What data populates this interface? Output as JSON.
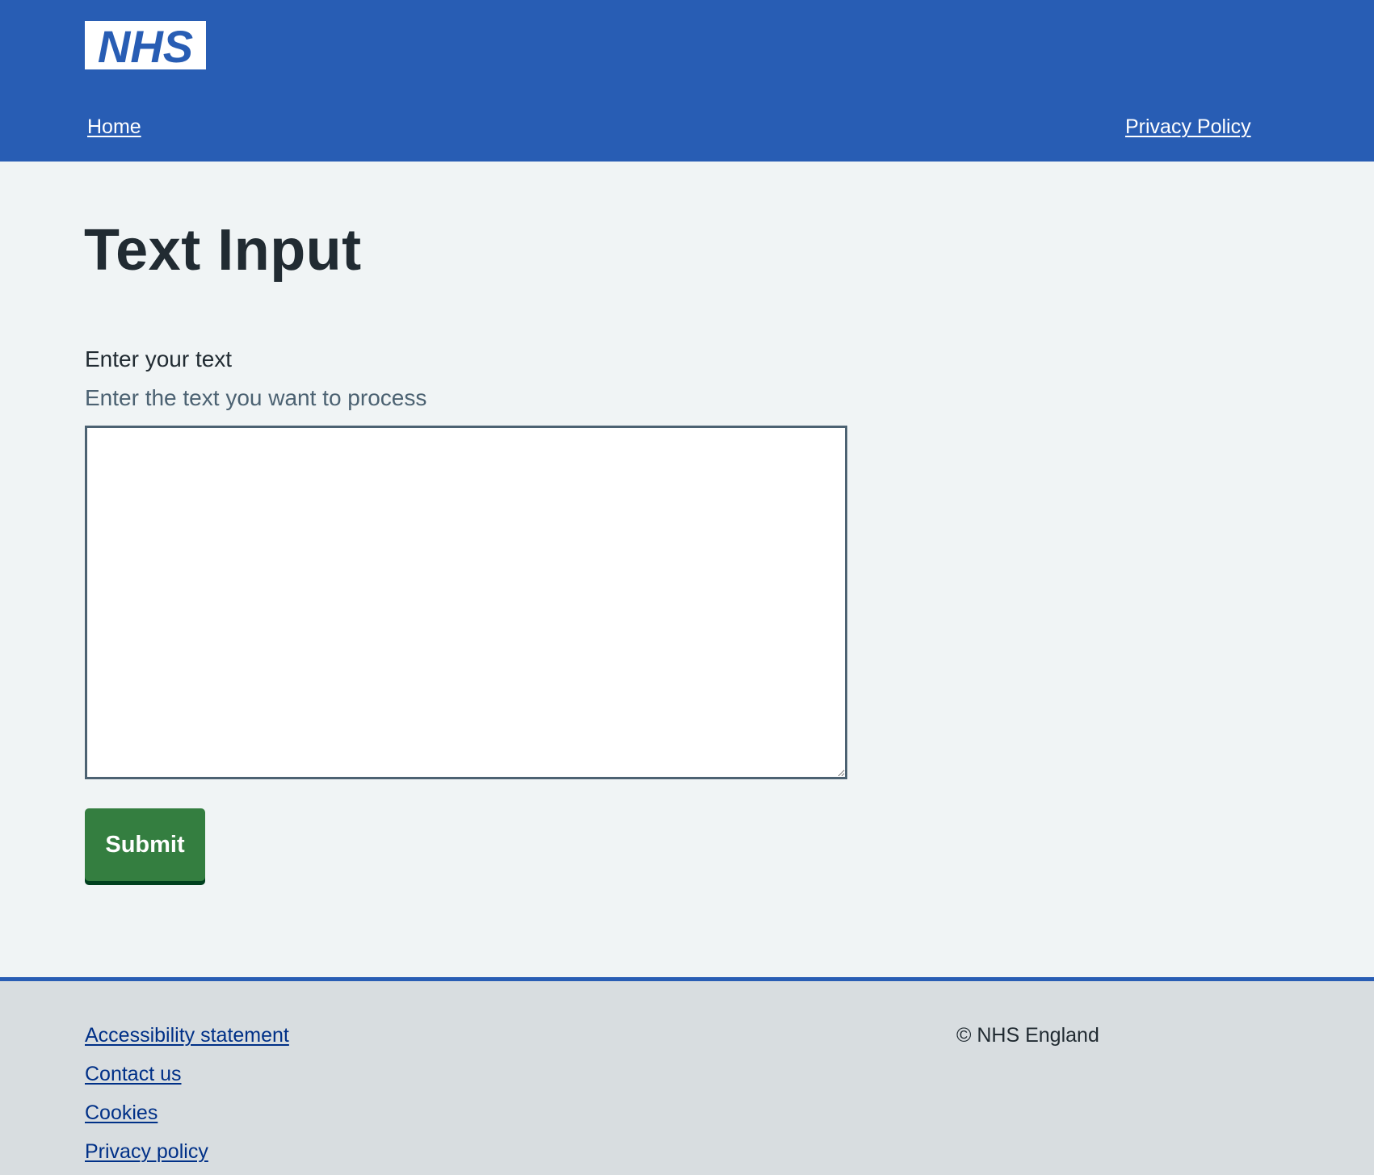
{
  "header": {
    "logo_text": "NHS",
    "nav": {
      "home_label": "Home",
      "privacy_label": "Privacy Policy"
    }
  },
  "main": {
    "title": "Text Input",
    "field": {
      "label": "Enter your text",
      "hint": "Enter the text you want to process",
      "value": ""
    },
    "submit_label": "Submit"
  },
  "footer": {
    "links": [
      "Accessibility statement",
      "Contact us",
      "Cookies",
      "Privacy policy"
    ],
    "copyright": "© NHS England"
  },
  "colors": {
    "brand_blue": "#285db4",
    "submit_green": "#347e40",
    "page_background": "#f0f4f5",
    "footer_background": "#d8dde0",
    "link_blue": "#003087"
  },
  "icons": {
    "logo": "nhs-logo-icon",
    "resize_handle": "resize-grip-icon"
  }
}
